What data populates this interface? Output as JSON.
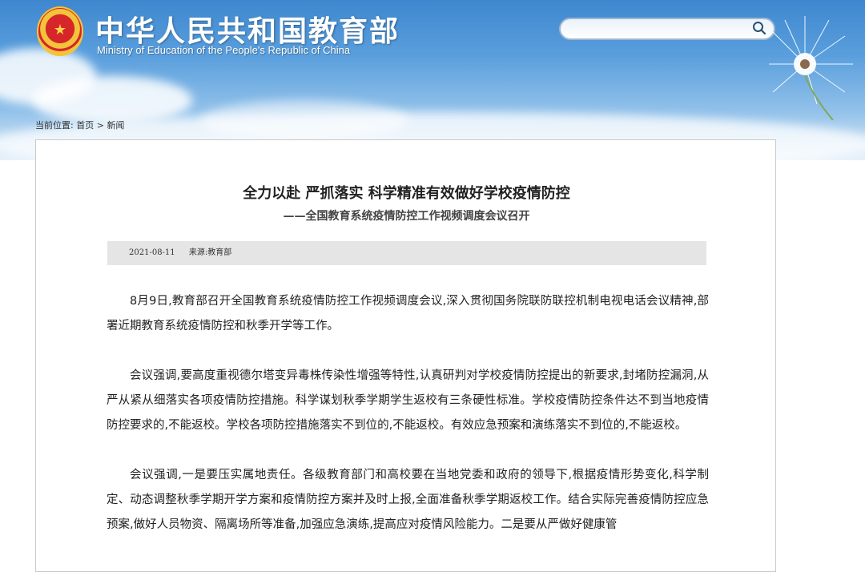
{
  "header": {
    "site_title": "中华人民共和国教育部",
    "site_subtitle": "Ministry of Education of the People's Republic of China",
    "search_placeholder": "",
    "colors": {
      "banner_top": "#3e87cf",
      "banner_bottom": "#e4f0fa"
    }
  },
  "breadcrumb": {
    "label": "当前位置:",
    "home": "首页",
    "separator": ">",
    "current": "新闻"
  },
  "article": {
    "title": "全力以赴 严抓落实 科学精准有效做好学校疫情防控",
    "subtitle": "——全国教育系统疫情防控工作视频调度会议召开",
    "date": "2021-08-11",
    "source": "来源:教育部",
    "paragraphs": [
      "8月9日,教育部召开全国教育系统疫情防控工作视频调度会议,深入贯彻国务院联防联控机制电视电话会议精神,部署近期教育系统疫情防控和秋季开学等工作。",
      "会议强调,要高度重视德尔塔变异毒株传染性增强等特性,认真研判对学校疫情防控提出的新要求,封堵防控漏洞,从严从紧从细落实各项疫情防控措施。科学谋划秋季学期学生返校有三条硬性标准。学校疫情防控条件达不到当地疫情防控要求的,不能返校。学校各项防控措施落实不到位的,不能返校。有效应急预案和演练落实不到位的,不能返校。",
      "会议强调,一是要压实属地责任。各级教育部门和高校要在当地党委和政府的领导下,根据疫情形势变化,科学制定、动态调整秋季学期开学方案和疫情防控方案并及时上报,全面准备秋季学期返校工作。结合实际完善疫情防控应急预案,做好人员物资、隔离场所等准备,加强应急演练,提高应对疫情风险能力。二是要从严做好健康管"
    ]
  }
}
